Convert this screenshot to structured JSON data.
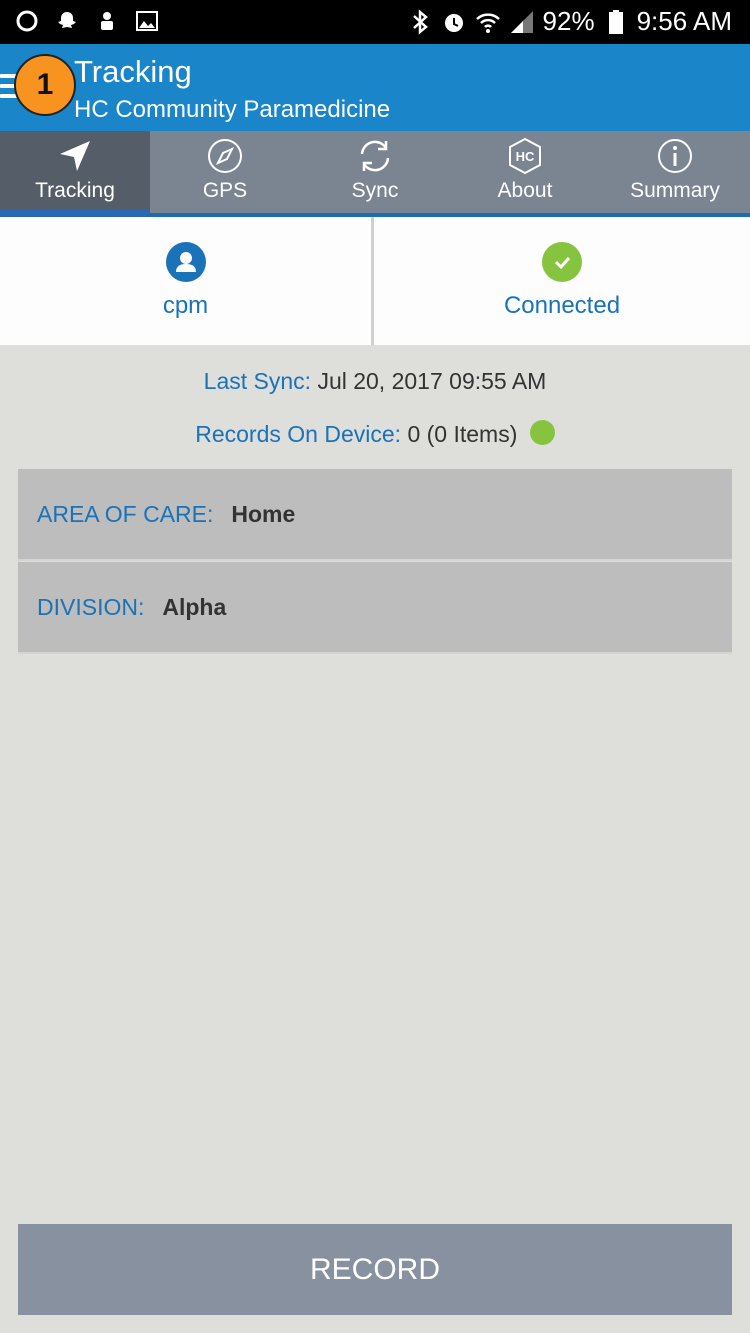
{
  "status_bar": {
    "battery": "92%",
    "time": "9:56 AM",
    "left_icons": [
      "circle-icon",
      "snapchat-icon",
      "robot-icon",
      "image-icon"
    ],
    "right_icons": [
      "bluetooth-icon",
      "alarm-icon",
      "wifi-icon",
      "signal-icon",
      "battery-icon"
    ]
  },
  "app_bar": {
    "title": "Tracking",
    "subtitle": "HC Community Paramedicine",
    "badge": "1",
    "color": "#1a85c8"
  },
  "tabs": [
    {
      "label": "Tracking",
      "icon": "navigation-arrow-icon",
      "active": true
    },
    {
      "label": "GPS",
      "icon": "compass-icon",
      "active": false
    },
    {
      "label": "Sync",
      "icon": "sync-icon",
      "active": false
    },
    {
      "label": "About",
      "icon": "hc-logo-icon",
      "active": false
    },
    {
      "label": "Summary",
      "icon": "info-icon",
      "active": false
    }
  ],
  "panels": {
    "user": {
      "label": "cpm",
      "icon": "user-icon"
    },
    "connection": {
      "label": "Connected",
      "icon": "check-icon",
      "color": "#86c440"
    }
  },
  "sync": {
    "last_sync_label": "Last Sync:",
    "last_sync_value": "Jul 20, 2017 09:55 AM",
    "records_label": "Records On Device:",
    "records_value": "0 (0 Items)",
    "records_status_color": "#86c440"
  },
  "info_rows": [
    {
      "label": "AREA OF CARE:",
      "value": "Home"
    },
    {
      "label": "DIVISION:",
      "value": "Alpha"
    }
  ],
  "record_button": {
    "label": "RECORD"
  }
}
